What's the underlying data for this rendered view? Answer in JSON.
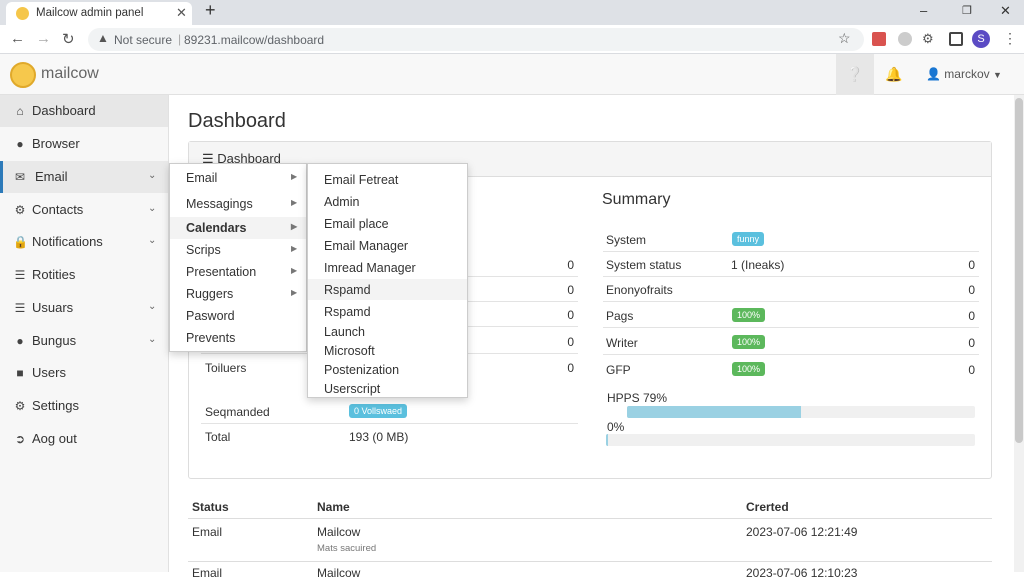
{
  "browser": {
    "tab_title": "Mailcow admin panel",
    "tab_close": "✕",
    "new_tab": "+",
    "security_label": "Not secure",
    "url": "89231.mailcow/dashboard",
    "profile_initial": "S",
    "colors": {
      "profile": "#5b4bc4"
    }
  },
  "app": {
    "brand": "mailcow",
    "user": "marckov",
    "colors": {
      "active_border": "#2d7ab9",
      "badge_info": "#5bc0de",
      "badge_green": "#5cb85c"
    }
  },
  "sidebar": {
    "items": [
      {
        "label": "Dashboard",
        "icon": "home-icon"
      },
      {
        "label": "Browser",
        "icon": "users-icon"
      },
      {
        "label": "Email",
        "icon": "envelope-icon"
      },
      {
        "label": "Contacts",
        "icon": "gear-icon"
      },
      {
        "label": "Notifications",
        "icon": "lock-icon"
      },
      {
        "label": "Rotities",
        "icon": "database-icon"
      },
      {
        "label": "Usuars",
        "icon": "list-icon"
      },
      {
        "label": "Bungus",
        "icon": "users-icon"
      },
      {
        "label": "Users",
        "icon": "file-icon"
      },
      {
        "label": "Settings",
        "icon": "gear-icon"
      },
      {
        "label": "Aog out",
        "icon": "sign-out-icon"
      }
    ]
  },
  "main": {
    "title": "Dashboard",
    "panel_heading": "Dashboard",
    "summary_title": "Summary",
    "summary_rows": [
      {
        "key": "System",
        "badge": "funny"
      },
      {
        "key": "System status",
        "value": "1 (Ineaks)",
        "num": "0"
      },
      {
        "key": "Enonyofraits",
        "num": "0"
      },
      {
        "key": "Pags",
        "badge": "100%",
        "num": "0"
      },
      {
        "key": "Writer",
        "badge": "100%",
        "num": "0"
      },
      {
        "key": "GFP",
        "badge": "100%",
        "num": "0"
      }
    ],
    "hpps_label": "HPPS 79%",
    "hpps_progress": 0.5,
    "zero_label": "0%",
    "zero_progress": 0.0,
    "left_rows": [
      {
        "num": "0"
      },
      {
        "num": "0"
      },
      {
        "num": "0"
      },
      {
        "num": "0"
      }
    ],
    "toiluers_label": "Toiluers",
    "toiluers_num": "0",
    "seqmanded_label": "Seqmanded",
    "seqmanded_badge": "0 Vollswaed",
    "total_label": "Total",
    "total_value": "193 (0 MB)"
  },
  "table": {
    "headers": [
      "Status",
      "Name",
      "Crerted"
    ],
    "rows": [
      {
        "status": "Email",
        "name": "Mailcow",
        "sub": "Mats sacuired",
        "created": "2023-07-06 12:21:49"
      },
      {
        "status": "Email",
        "name": "Mailcow",
        "created": "2023-07-06 12:10:23"
      }
    ]
  },
  "menu1": {
    "items": [
      {
        "label": "Email",
        "arrow": "▶"
      },
      {
        "label": "Messagings",
        "arrow": "▶"
      },
      {
        "label": "Calendars",
        "arrow": "▶"
      },
      {
        "label": "Scrips",
        "arrow": "▶"
      },
      {
        "label": "Presentation",
        "arrow": "▶"
      },
      {
        "label": "Ruggers",
        "arrow": "▶"
      },
      {
        "label": "Pasword"
      },
      {
        "label": "Prevents"
      }
    ]
  },
  "menu2": {
    "items": [
      "Email Fetreat",
      "Admin",
      "Email place",
      "Email Manager",
      "Imread Manager",
      "Rspamd",
      "Rspamd",
      "Launch",
      "Microsoft",
      "Postenization",
      "Userscript"
    ]
  }
}
